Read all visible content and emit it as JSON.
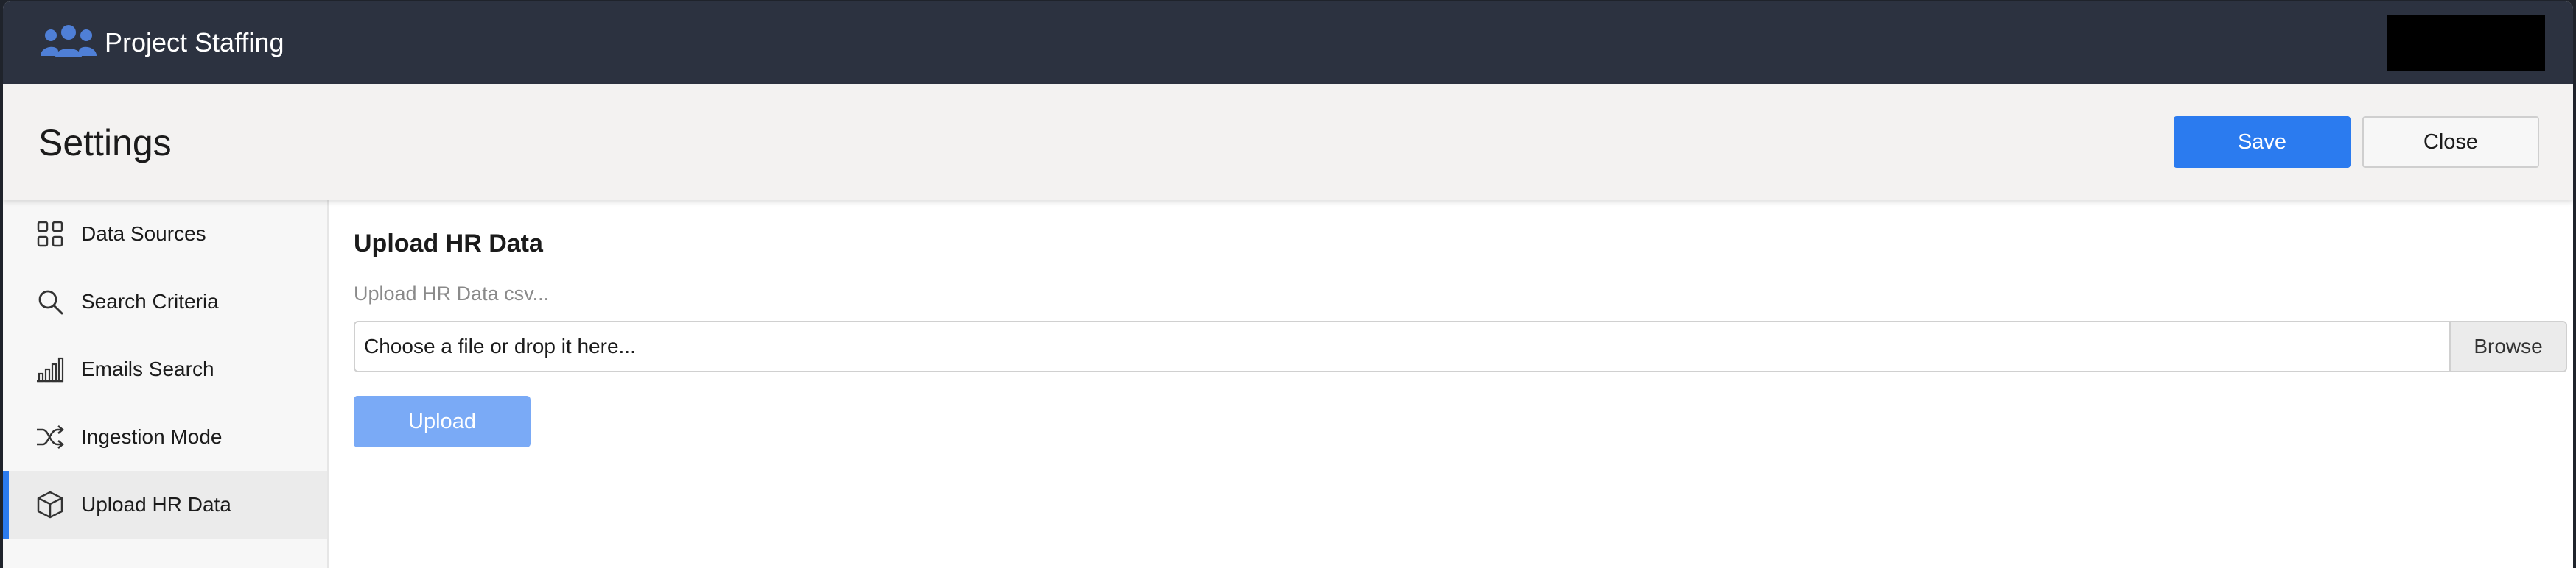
{
  "app": {
    "title": "Project Staffing",
    "icon": "users-icon"
  },
  "header": {
    "title": "Settings",
    "save_label": "Save",
    "close_label": "Close"
  },
  "sidebar": {
    "items": [
      {
        "label": "Data Sources",
        "icon": "grid-icon"
      },
      {
        "label": "Search Criteria",
        "icon": "search-icon"
      },
      {
        "label": "Emails Search",
        "icon": "bar-chart-icon"
      },
      {
        "label": "Ingestion Mode",
        "icon": "shuffle-icon"
      },
      {
        "label": "Upload HR Data",
        "icon": "box-icon",
        "active": true
      }
    ]
  },
  "main": {
    "section_title": "Upload HR Data",
    "field_label": "Upload HR Data csv...",
    "file_placeholder": "Choose a file or drop it here...",
    "browse_label": "Browse",
    "upload_label": "Upload"
  },
  "colors": {
    "topbar": "#2c3240",
    "accent": "#2b7bef",
    "upload_disabled": "#7aaaf6",
    "header_bg": "#f3f2f1"
  }
}
